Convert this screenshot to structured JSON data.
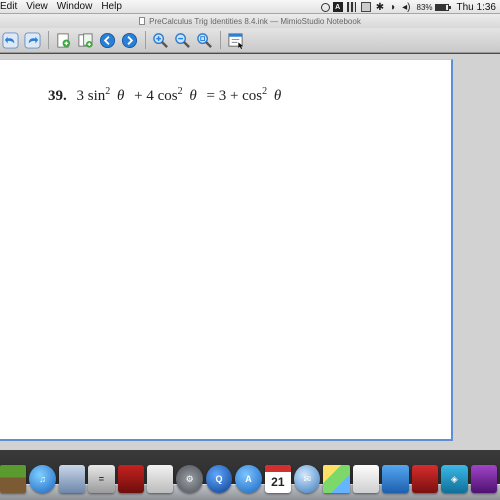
{
  "menubar": {
    "items": [
      "Edit",
      "View",
      "Window",
      "Help"
    ],
    "battery": "83%",
    "clock": "Thu 1:36"
  },
  "window": {
    "title": "PreCalculus Trig Identities 8.4.ink — MimioStudio Notebook"
  },
  "toolbar": {
    "buttons": [
      {
        "name": "undo-icon"
      },
      {
        "name": "redo-icon"
      },
      {
        "name": "add-page-icon"
      },
      {
        "name": "insert-page-icon"
      },
      {
        "name": "previous-page-icon"
      },
      {
        "name": "next-page-icon"
      },
      {
        "name": "zoom-in-icon"
      },
      {
        "name": "zoom-out-icon"
      },
      {
        "name": "zoom-fit-icon"
      },
      {
        "name": "page-view-icon"
      }
    ]
  },
  "page": {
    "problem_number": "39.",
    "equation_lhs_a": "3 sin",
    "equation_lhs_b": "+ 4 cos",
    "equation_rhs": "= 3 + cos",
    "exponent": "2",
    "theta": "θ"
  },
  "dock": {
    "calendar_day": "21",
    "apps": [
      "minecraft-icon",
      "itunes-icon",
      "preview-icon",
      "calculator-icon",
      "photo-booth-icon",
      "system-preferences-icon",
      "quicktime-icon",
      "app-store-icon",
      "ical-icon",
      "mail-icon",
      "stickies-icon",
      "textedit-icon",
      "pdf-icon",
      "mimio-icon",
      "app-icon"
    ]
  },
  "colors": {
    "page_border": "#5c8fd8",
    "workspace": "#d2d2d2",
    "toolbar_icon_blue": "#2a7fd6"
  }
}
